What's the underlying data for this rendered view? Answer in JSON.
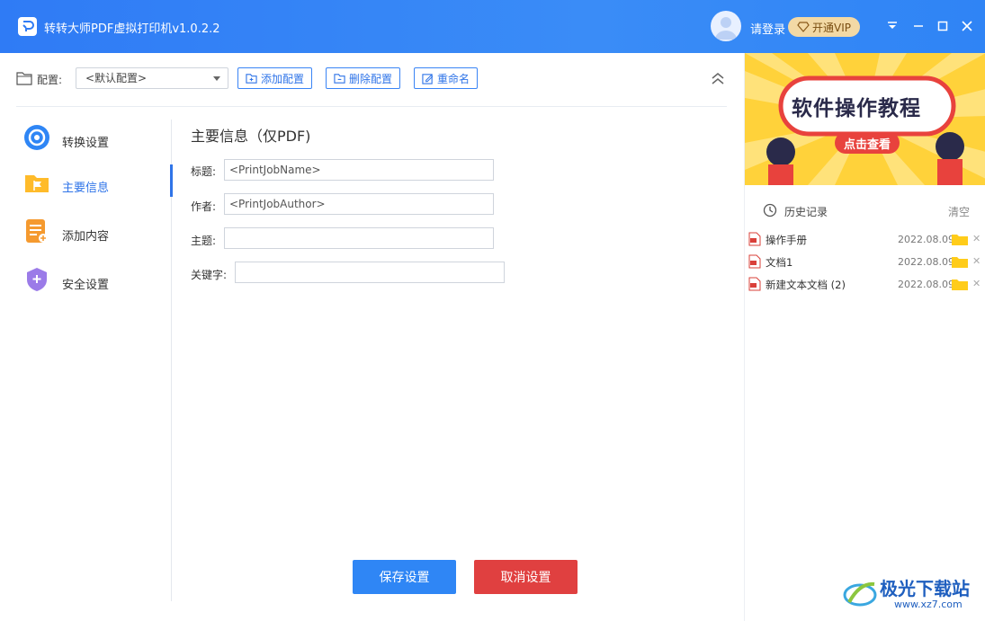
{
  "titlebar": {
    "app_title": "转转大师PDF虚拟打印机v1.0.2.2",
    "login_text": "请登录",
    "vip_label": "开通VIP"
  },
  "toolbar": {
    "config_label": "配置:",
    "config_selected": "<默认配置>",
    "add_config": "添加配置",
    "delete_config": "删除配置",
    "rename": "重命名"
  },
  "nav": {
    "items": [
      {
        "label": "转换设置",
        "icon": "convert-icon"
      },
      {
        "label": "主要信息",
        "icon": "folder-flag-icon"
      },
      {
        "label": "添加内容",
        "icon": "document-add-icon"
      },
      {
        "label": "安全设置",
        "icon": "shield-icon"
      }
    ],
    "active_index": 1
  },
  "main": {
    "title": "主要信息（仅PDF)",
    "fields": {
      "title_label": "标题:",
      "title_value": "<PrintJobName>",
      "author_label": "作者:",
      "author_value": "<PrintJobAuthor>",
      "subject_label": "主题:",
      "subject_value": "",
      "keywords_label": "关键字:",
      "keywords_value": ""
    },
    "save_label": "保存设置",
    "cancel_label": "取消设置"
  },
  "banner": {
    "title": "软件操作教程",
    "subtitle": "点击查看"
  },
  "history": {
    "title": "历史记录",
    "clear_label": "清空",
    "rows": [
      {
        "name": "操作手册",
        "date": "2022.08.09"
      },
      {
        "name": "文档1",
        "date": "2022.08.09"
      },
      {
        "name": "新建文本文档 (2)",
        "date": "2022.08.09"
      }
    ]
  },
  "watermark": {
    "text": "极光下载站",
    "url": "www.xz7.com"
  },
  "colors": {
    "accent": "#2f74e8",
    "titlebar": "#3a8cf7",
    "save": "#2f86f5",
    "cancel": "#e04040",
    "vip": "#f3d9a5",
    "banner": "#ffd23a"
  }
}
